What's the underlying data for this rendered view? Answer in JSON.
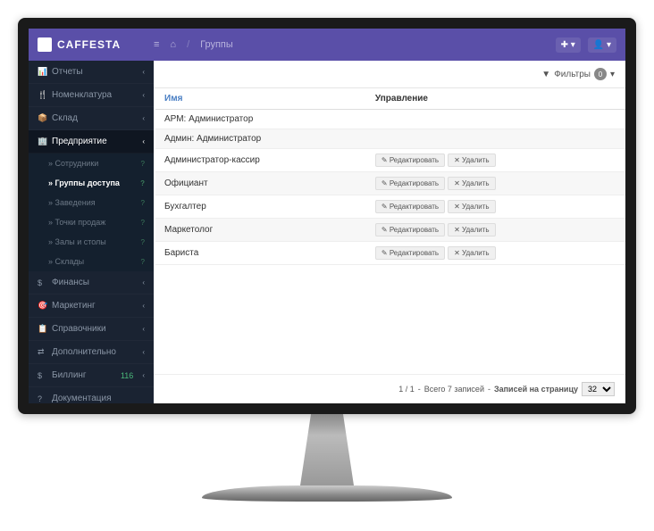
{
  "brand": "CAFFESTA",
  "breadcrumb": {
    "current": "Группы"
  },
  "sidebar": {
    "items": [
      {
        "icon": "📊",
        "label": "Отчеты"
      },
      {
        "icon": "🍴",
        "label": "Номенклатура"
      },
      {
        "icon": "📦",
        "label": "Склад"
      },
      {
        "icon": "🏢",
        "label": "Предприятие"
      },
      {
        "icon": "$",
        "label": "Финансы"
      },
      {
        "icon": "🎯",
        "label": "Маркетинг"
      },
      {
        "icon": "📋",
        "label": "Справочники"
      },
      {
        "icon": "⇄",
        "label": "Дополнительно"
      },
      {
        "icon": "$",
        "label": "Биллинг",
        "badge": "116"
      },
      {
        "icon": "?",
        "label": "Документация"
      }
    ],
    "submenu": [
      {
        "label": "Сотрудники"
      },
      {
        "label": "Группы доступа"
      },
      {
        "label": "Заведения"
      },
      {
        "label": "Точки продаж"
      },
      {
        "label": "Залы и столы"
      },
      {
        "label": "Склады"
      }
    ]
  },
  "filters": {
    "label": "Фильтры",
    "count": "0"
  },
  "table": {
    "headers": {
      "name": "Имя",
      "actions": "Управление"
    },
    "rows": [
      {
        "name": "АРМ: Администратор",
        "editable": false
      },
      {
        "name": "Админ: Администратор",
        "editable": false
      },
      {
        "name": "Администратор-кассир",
        "editable": true
      },
      {
        "name": "Официант",
        "editable": true
      },
      {
        "name": "Бухгалтер",
        "editable": true
      },
      {
        "name": "Маркетолог",
        "editable": true
      },
      {
        "name": "Бариста",
        "editable": true
      }
    ],
    "actions": {
      "edit": "Редактировать",
      "delete": "Удалить"
    }
  },
  "pagination": {
    "pages": "1 / 1",
    "separator": " - ",
    "total": "Всего 7 записей",
    "perPageLabel": "Записей на страницу",
    "perPage": "32"
  }
}
